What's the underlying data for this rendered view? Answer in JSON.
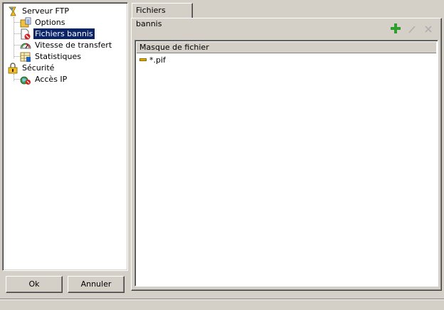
{
  "tree": {
    "items": [
      {
        "label": "Serveur FTP",
        "icon": "ftp-server-icon"
      },
      {
        "label": "Options",
        "icon": "options-icon"
      },
      {
        "label": "Fichiers bannis",
        "icon": "banned-files-icon",
        "selected": true
      },
      {
        "label": "Vitesse de transfert",
        "icon": "speed-gauge-icon"
      },
      {
        "label": "Statistiques",
        "icon": "statistics-icon"
      },
      {
        "label": "Sécurité",
        "icon": "security-lock-icon"
      },
      {
        "label": "Accès IP",
        "icon": "ip-access-icon"
      }
    ]
  },
  "buttons": {
    "ok": "Ok",
    "cancel": "Annuler"
  },
  "tab": {
    "label": "Fichiers bannis"
  },
  "toolbar": {
    "add": "add-icon",
    "edit": "edit-icon",
    "delete": "delete-icon"
  },
  "list": {
    "column_header": "Masque de fichier",
    "rows": [
      {
        "mask": "*.pif"
      }
    ]
  },
  "colors": {
    "selection": "#0a246a",
    "face": "#d4d0c8",
    "add_green": "#2e9e2e"
  }
}
